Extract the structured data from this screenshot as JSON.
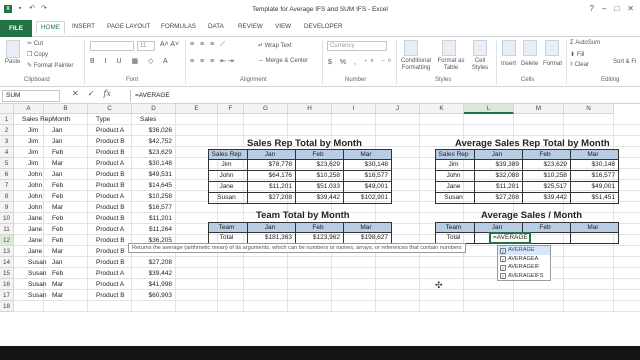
{
  "window": {
    "title": "Template for Average IFS and SUM IFS - Excel"
  },
  "ribbon_tabs": {
    "file": "FILE",
    "home": "HOME",
    "insert": "INSERT",
    "page_layout": "PAGE LAYOUT",
    "formulas": "FORMULAS",
    "data": "DATA",
    "review": "REVIEW",
    "view": "VIEW",
    "developer": "DEVELOPER"
  },
  "ribbon": {
    "cut": "Cut",
    "copy": "Copy",
    "format_painter": "Format Painter",
    "paste": "Paste",
    "font_size": "11",
    "wrap_text": "Wrap Text",
    "merge_center": "Merge & Center",
    "number_format": "Currency",
    "conditional_formatting": "Conditional Formatting",
    "format_as_table": "Format as Table",
    "cell_styles": "Cell Styles",
    "insert": "Insert",
    "delete": "Delete",
    "format": "Format",
    "autosum": "AutoSum",
    "fill": "Fill",
    "clear": "Clear",
    "sort_filter": "Sort & Fi",
    "groups": {
      "clipboard": "Clipboard",
      "font": "Font",
      "alignment": "Alignment",
      "number": "Number",
      "styles": "Styles",
      "cells": "Cells",
      "editing": "Editing"
    }
  },
  "formula_bar": {
    "name_box": "SUM",
    "formula": "=AVERAGE"
  },
  "columns": [
    "A",
    "B",
    "C",
    "D",
    "E",
    "F",
    "G",
    "H",
    "I",
    "J",
    "K",
    "L",
    "M",
    "N"
  ],
  "rows": [
    "1",
    "2",
    "3",
    "4",
    "5",
    "6",
    "7",
    "8",
    "9",
    "10",
    "11",
    "12",
    "13",
    "14",
    "15",
    "16",
    "17",
    "18"
  ],
  "raw_table": {
    "headers": [
      "Sales Rep",
      "Month",
      "Type",
      "Sales"
    ],
    "rows": [
      [
        "Jim",
        "Jan",
        "Product A",
        "$36,026"
      ],
      [
        "Jim",
        "Jan",
        "Product B",
        "$42,752"
      ],
      [
        "Jim",
        "Feb",
        "Product B",
        "$23,629"
      ],
      [
        "Jim",
        "Mar",
        "Product A",
        "$30,148"
      ],
      [
        "John",
        "Jan",
        "Product B",
        "$49,531"
      ],
      [
        "John",
        "Feb",
        "Product B",
        "$14,645"
      ],
      [
        "John",
        "Feb",
        "Product A",
        "$10,258"
      ],
      [
        "John",
        "Mar",
        "Product B",
        "$16,577"
      ],
      [
        "Jane",
        "Feb",
        "Product B",
        "$11,201"
      ],
      [
        "Jane",
        "Feb",
        "Product A",
        "$11,264"
      ],
      [
        "Jane",
        "Feb",
        "Product B",
        "$36,205"
      ],
      [
        "Jane",
        "Mar",
        "Product B",
        ""
      ],
      [
        "Susan",
        "Jan",
        "Product B",
        "$27,208"
      ],
      [
        "Susan",
        "Feb",
        "Product A",
        "$39,442"
      ],
      [
        "Susan",
        "Mar",
        "Product A",
        "$41,998"
      ],
      [
        "Susan",
        "Mar",
        "Product B",
        "$60,903"
      ]
    ]
  },
  "sales_rep_total": {
    "title": "Sales Rep Total by Month",
    "headers": [
      "Sales Rep",
      "Jan",
      "Feb",
      "Mar"
    ],
    "rows": [
      [
        "Jim",
        "$78,778",
        "$23,629",
        "$30,148"
      ],
      [
        "John",
        "$64,176",
        "$10,258",
        "$16,577"
      ],
      [
        "Jane",
        "$11,201",
        "$51,033",
        "$49,001"
      ],
      [
        "Susan",
        "$27,208",
        "$39,442",
        "$102,901"
      ]
    ]
  },
  "team_total": {
    "title": "Team Total by Month",
    "headers": [
      "Team",
      "Jan",
      "Feb",
      "Mar"
    ],
    "row": [
      "Total",
      "$181,363",
      "$123,962",
      "$198,627"
    ]
  },
  "avg_sales_rep": {
    "title": "Average Sales Rep Total by Month",
    "headers": [
      "Sales Rep",
      "Jan",
      "Feb",
      "Mar"
    ],
    "rows": [
      [
        "Jim",
        "$39,389",
        "$23,629",
        "$30,148"
      ],
      [
        "John",
        "$32,088",
        "$10,258",
        "$16,577"
      ],
      [
        "Jane",
        "$11,201",
        "$25,517",
        "$49,001"
      ],
      [
        "Susan",
        "$27,208",
        "$39,442",
        "$51,451"
      ]
    ]
  },
  "avg_sales_month": {
    "title": "Average Sales / Month",
    "headers": [
      "Team",
      "Jan",
      "Feb",
      "Mar"
    ],
    "row": [
      "Total",
      "=AVERAGE",
      "",
      ""
    ]
  },
  "tooltip": "Returns the average (arithmetic mean) of its arguments, which can be numbers or names, arrays, or references that contain numbers",
  "autocomplete": [
    "AVERAGE",
    "AVERAGEA",
    "AVERAGEIF",
    "AVERAGEIFS"
  ]
}
